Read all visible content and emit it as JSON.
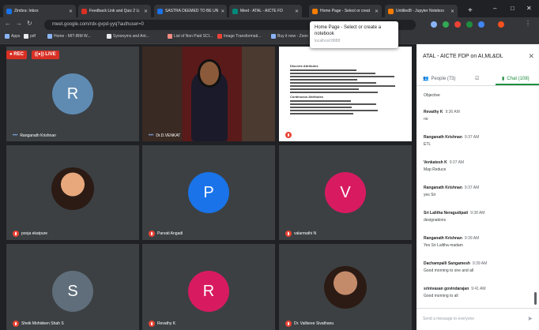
{
  "browser": {
    "tabs": [
      {
        "title": "Zimbra: Inbox",
        "color": "#1a73e8"
      },
      {
        "title": "Feedback Link and Quiz 2 Li",
        "color": "#d93025"
      },
      {
        "title": "SASTRA DEEMED TO BE UN",
        "color": "#1a73e8"
      },
      {
        "title": "Meet - ATAL - AICTE FD",
        "color": "#00897b"
      },
      {
        "title": "Home Page - Select or creat",
        "color": "#f57c00"
      },
      {
        "title": "Untitled8 - Jupyter Noteboo",
        "color": "#f57c00"
      }
    ],
    "new_tab": "+",
    "url": "meet.google.com/rdx-gvpd-yyq?authuser=0",
    "bookmarks": [
      {
        "label": "Apps",
        "color": "#8ab4f8"
      },
      {
        "label": "pdf",
        "color": "#e8eaed"
      },
      {
        "label": "Home - MIT-IBM W...",
        "color": "#8ab4f8"
      },
      {
        "label": "Synonyms and Ant...",
        "color": "#e8eaed"
      },
      {
        "label": "List of Non Paid SCI...",
        "color": "#f28b82"
      },
      {
        "label": "Image Transformati...",
        "color": "#ea4335"
      },
      {
        "label": "Buy it now - Zoon",
        "color": "#8ab4f8"
      }
    ],
    "tooltip": {
      "title": "Home Page - Select or create a notebook",
      "url": "localhost:8888"
    }
  },
  "meet": {
    "rec_label": "REC",
    "live_label": "LIVE",
    "participants": [
      {
        "name": "Ranganath Krishnan",
        "initial": "R",
        "color": "#5f8bb3",
        "type": "avatar",
        "audio": "speaking"
      },
      {
        "name": "Dr.D.VENKAT",
        "initial": "",
        "color": "",
        "type": "video",
        "audio": "speaking"
      },
      {
        "name": "",
        "initial": "",
        "color": "",
        "type": "presentation",
        "audio": "muted"
      },
      {
        "name": "pooja ekatpure",
        "initial": "",
        "color": "#e8a87c",
        "type": "photo",
        "audio": "muted"
      },
      {
        "name": "Parvati Angadi",
        "initial": "P",
        "color": "#1a73e8",
        "type": "avatar",
        "audio": "muted"
      },
      {
        "name": "valarmathi N",
        "initial": "V",
        "color": "#d81b60",
        "type": "avatar",
        "audio": "muted"
      },
      {
        "name": "Sheik Mohideen Shah S",
        "initial": "S",
        "color": "#5f6e7a",
        "type": "avatar",
        "audio": "muted"
      },
      {
        "name": "Revathy K",
        "initial": "R",
        "color": "#d81b60",
        "type": "avatar",
        "audio": "muted"
      },
      {
        "name": "Dr. Vallisree Sivathanu",
        "initial": "",
        "color": "#c48b6a",
        "type": "photo",
        "audio": "muted"
      }
    ],
    "slide": {
      "heading1": "Discrete Attributes",
      "heading2": "Continuous Attributes"
    }
  },
  "panel": {
    "title": "ATAL - AICTE FDP on AI,ML&DL",
    "people_tab": "People (73)",
    "chat_tab": "Chat (108)",
    "first_text": "Objective",
    "messages": [
      {
        "sender": "Revathy K",
        "time": "9:36 AM",
        "text": "no"
      },
      {
        "sender": "Ranganath Krishnan",
        "time": "9:37 AM",
        "text": "ETL"
      },
      {
        "sender": "Venkatesh K",
        "time": "9:37 AM",
        "text": "Map Reduce"
      },
      {
        "sender": "Ranganath Krishnan",
        "time": "9:37 AM",
        "text": "yes Sir"
      },
      {
        "sender": "Sri Lalitha Neragudipati",
        "time": "9:38 AM",
        "text": "designations"
      },
      {
        "sender": "Ranganath Krishnan",
        "time": "9:39 AM",
        "text": "Yes Sri Lalitha madam"
      },
      {
        "sender": "Dachampalli Sangamesh",
        "time": "9:39 AM",
        "text": "Good morning to one and all"
      },
      {
        "sender": "srinivasan govindarajan",
        "time": "9:41 AM",
        "text": "Good morning to all"
      }
    ],
    "send_placeholder": "Send a message to everyone",
    "accent": "#1e8e3e"
  }
}
